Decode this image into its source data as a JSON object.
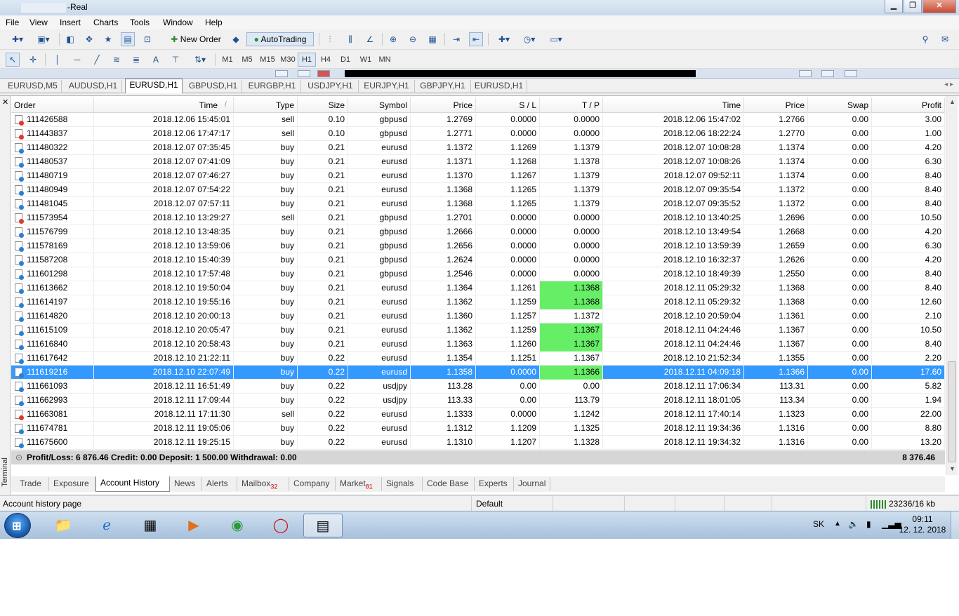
{
  "window": {
    "title": "-Real",
    "minimize": "▁",
    "restore": "❐",
    "close": "✕"
  },
  "menu": [
    "File",
    "View",
    "Insert",
    "Charts",
    "Tools",
    "Window",
    "Help"
  ],
  "toolbar": {
    "new_order": "New Order",
    "auto_trading": "AutoTrading",
    "timeframes": [
      "M1",
      "M5",
      "M15",
      "M30",
      "H1",
      "H4",
      "D1",
      "W1",
      "MN"
    ],
    "active_timeframe": "H1"
  },
  "chart_tabs": {
    "items": [
      "EURUSD,M5",
      "AUDUSD,H1",
      "EURUSD,H1",
      "GBPUSD,H1",
      "EURGBP,H1",
      "USDJPY,H1",
      "EURJPY,H1",
      "GBPJPY,H1",
      "EURUSD,H1"
    ],
    "active_index": 2,
    "arrows": "◂ ▸"
  },
  "terminal": {
    "side_label": "Terminal",
    "close": "✕",
    "columns": [
      "Order",
      "Time",
      "Type",
      "Size",
      "Symbol",
      "Price",
      "S / L",
      "T / P",
      "Time",
      "Price",
      "Swap",
      "Profit"
    ],
    "sort_indicator": "/",
    "rows": [
      {
        "order": "111426588",
        "open_time": "2018.12.06 15:45:01",
        "type": "sell",
        "size": "0.10",
        "symbol": "gbpusd",
        "price": "1.2769",
        "sl": "0.0000",
        "tp": "0.0000",
        "close_time": "2018.12.06 15:47:02",
        "close_price": "1.2766",
        "swap": "0.00",
        "profit": "3.00",
        "tp_hit": false
      },
      {
        "order": "111443837",
        "open_time": "2018.12.06 17:47:17",
        "type": "sell",
        "size": "0.10",
        "symbol": "gbpusd",
        "price": "1.2771",
        "sl": "0.0000",
        "tp": "0.0000",
        "close_time": "2018.12.06 18:22:24",
        "close_price": "1.2770",
        "swap": "0.00",
        "profit": "1.00",
        "tp_hit": false
      },
      {
        "order": "111480322",
        "open_time": "2018.12.07 07:35:45",
        "type": "buy",
        "size": "0.21",
        "symbol": "eurusd",
        "price": "1.1372",
        "sl": "1.1269",
        "tp": "1.1379",
        "close_time": "2018.12.07 10:08:28",
        "close_price": "1.1374",
        "swap": "0.00",
        "profit": "4.20",
        "tp_hit": false
      },
      {
        "order": "111480537",
        "open_time": "2018.12.07 07:41:09",
        "type": "buy",
        "size": "0.21",
        "symbol": "eurusd",
        "price": "1.1371",
        "sl": "1.1268",
        "tp": "1.1378",
        "close_time": "2018.12.07 10:08:26",
        "close_price": "1.1374",
        "swap": "0.00",
        "profit": "6.30",
        "tp_hit": false
      },
      {
        "order": "111480719",
        "open_time": "2018.12.07 07:46:27",
        "type": "buy",
        "size": "0.21",
        "symbol": "eurusd",
        "price": "1.1370",
        "sl": "1.1267",
        "tp": "1.1379",
        "close_time": "2018.12.07 09:52:11",
        "close_price": "1.1374",
        "swap": "0.00",
        "profit": "8.40",
        "tp_hit": false
      },
      {
        "order": "111480949",
        "open_time": "2018.12.07 07:54:22",
        "type": "buy",
        "size": "0.21",
        "symbol": "eurusd",
        "price": "1.1368",
        "sl": "1.1265",
        "tp": "1.1379",
        "close_time": "2018.12.07 09:35:54",
        "close_price": "1.1372",
        "swap": "0.00",
        "profit": "8.40",
        "tp_hit": false
      },
      {
        "order": "111481045",
        "open_time": "2018.12.07 07:57:11",
        "type": "buy",
        "size": "0.21",
        "symbol": "eurusd",
        "price": "1.1368",
        "sl": "1.1265",
        "tp": "1.1379",
        "close_time": "2018.12.07 09:35:52",
        "close_price": "1.1372",
        "swap": "0.00",
        "profit": "8.40",
        "tp_hit": false
      },
      {
        "order": "111573954",
        "open_time": "2018.12.10 13:29:27",
        "type": "sell",
        "size": "0.21",
        "symbol": "gbpusd",
        "price": "1.2701",
        "sl": "0.0000",
        "tp": "0.0000",
        "close_time": "2018.12.10 13:40:25",
        "close_price": "1.2696",
        "swap": "0.00",
        "profit": "10.50",
        "tp_hit": false
      },
      {
        "order": "111576799",
        "open_time": "2018.12.10 13:48:35",
        "type": "buy",
        "size": "0.21",
        "symbol": "gbpusd",
        "price": "1.2666",
        "sl": "0.0000",
        "tp": "0.0000",
        "close_time": "2018.12.10 13:49:54",
        "close_price": "1.2668",
        "swap": "0.00",
        "profit": "4.20",
        "tp_hit": false
      },
      {
        "order": "111578169",
        "open_time": "2018.12.10 13:59:06",
        "type": "buy",
        "size": "0.21",
        "symbol": "gbpusd",
        "price": "1.2656",
        "sl": "0.0000",
        "tp": "0.0000",
        "close_time": "2018.12.10 13:59:39",
        "close_price": "1.2659",
        "swap": "0.00",
        "profit": "6.30",
        "tp_hit": false
      },
      {
        "order": "111587208",
        "open_time": "2018.12.10 15:40:39",
        "type": "buy",
        "size": "0.21",
        "symbol": "gbpusd",
        "price": "1.2624",
        "sl": "0.0000",
        "tp": "0.0000",
        "close_time": "2018.12.10 16:32:37",
        "close_price": "1.2626",
        "swap": "0.00",
        "profit": "4.20",
        "tp_hit": false
      },
      {
        "order": "111601298",
        "open_time": "2018.12.10 17:57:48",
        "type": "buy",
        "size": "0.21",
        "symbol": "gbpusd",
        "price": "1.2546",
        "sl": "0.0000",
        "tp": "0.0000",
        "close_time": "2018.12.10 18:49:39",
        "close_price": "1.2550",
        "swap": "0.00",
        "profit": "8.40",
        "tp_hit": false
      },
      {
        "order": "111613662",
        "open_time": "2018.12.10 19:50:04",
        "type": "buy",
        "size": "0.21",
        "symbol": "eurusd",
        "price": "1.1364",
        "sl": "1.1261",
        "tp": "1.1368",
        "close_time": "2018.12.11 05:29:32",
        "close_price": "1.1368",
        "swap": "0.00",
        "profit": "8.40",
        "tp_hit": true
      },
      {
        "order": "111614197",
        "open_time": "2018.12.10 19:55:16",
        "type": "buy",
        "size": "0.21",
        "symbol": "eurusd",
        "price": "1.1362",
        "sl": "1.1259",
        "tp": "1.1368",
        "close_time": "2018.12.11 05:29:32",
        "close_price": "1.1368",
        "swap": "0.00",
        "profit": "12.60",
        "tp_hit": true
      },
      {
        "order": "111614820",
        "open_time": "2018.12.10 20:00:13",
        "type": "buy",
        "size": "0.21",
        "symbol": "eurusd",
        "price": "1.1360",
        "sl": "1.1257",
        "tp": "1.1372",
        "close_time": "2018.12.10 20:59:04",
        "close_price": "1.1361",
        "swap": "0.00",
        "profit": "2.10",
        "tp_hit": false
      },
      {
        "order": "111615109",
        "open_time": "2018.12.10 20:05:47",
        "type": "buy",
        "size": "0.21",
        "symbol": "eurusd",
        "price": "1.1362",
        "sl": "1.1259",
        "tp": "1.1367",
        "close_time": "2018.12.11 04:24:46",
        "close_price": "1.1367",
        "swap": "0.00",
        "profit": "10.50",
        "tp_hit": true
      },
      {
        "order": "111616840",
        "open_time": "2018.12.10 20:58:43",
        "type": "buy",
        "size": "0.21",
        "symbol": "eurusd",
        "price": "1.1363",
        "sl": "1.1260",
        "tp": "1.1367",
        "close_time": "2018.12.11 04:24:46",
        "close_price": "1.1367",
        "swap": "0.00",
        "profit": "8.40",
        "tp_hit": true
      },
      {
        "order": "111617642",
        "open_time": "2018.12.10 21:22:11",
        "type": "buy",
        "size": "0.22",
        "symbol": "eurusd",
        "price": "1.1354",
        "sl": "1.1251",
        "tp": "1.1367",
        "close_time": "2018.12.10 21:52:34",
        "close_price": "1.1355",
        "swap": "0.00",
        "profit": "2.20",
        "tp_hit": false
      },
      {
        "order": "111619216",
        "open_time": "2018.12.10 22:07:49",
        "type": "buy",
        "size": "0.22",
        "symbol": "eurusd",
        "price": "1.1358",
        "sl": "0.0000",
        "tp": "1.1366",
        "close_time": "2018.12.11 04:09:18",
        "close_price": "1.1366",
        "swap": "0.00",
        "profit": "17.60",
        "tp_hit": true,
        "selected": true
      },
      {
        "order": "111661093",
        "open_time": "2018.12.11 16:51:49",
        "type": "buy",
        "size": "0.22",
        "symbol": "usdjpy",
        "price": "113.28",
        "sl": "0.00",
        "tp": "0.00",
        "close_time": "2018.12.11 17:06:34",
        "close_price": "113.31",
        "swap": "0.00",
        "profit": "5.82",
        "tp_hit": false
      },
      {
        "order": "111662993",
        "open_time": "2018.12.11 17:09:44",
        "type": "buy",
        "size": "0.22",
        "symbol": "usdjpy",
        "price": "113.33",
        "sl": "0.00",
        "tp": "113.79",
        "close_time": "2018.12.11 18:01:05",
        "close_price": "113.34",
        "swap": "0.00",
        "profit": "1.94",
        "tp_hit": false
      },
      {
        "order": "111663081",
        "open_time": "2018.12.11 17:11:30",
        "type": "sell",
        "size": "0.22",
        "symbol": "eurusd",
        "price": "1.1333",
        "sl": "0.0000",
        "tp": "1.1242",
        "close_time": "2018.12.11 17:40:14",
        "close_price": "1.1323",
        "swap": "0.00",
        "profit": "22.00",
        "tp_hit": false
      },
      {
        "order": "111674781",
        "open_time": "2018.12.11 19:05:06",
        "type": "buy",
        "size": "0.22",
        "symbol": "eurusd",
        "price": "1.1312",
        "sl": "1.1209",
        "tp": "1.1325",
        "close_time": "2018.12.11 19:34:36",
        "close_price": "1.1316",
        "swap": "0.00",
        "profit": "8.80",
        "tp_hit": false
      },
      {
        "order": "111675600",
        "open_time": "2018.12.11 19:25:15",
        "type": "buy",
        "size": "0.22",
        "symbol": "eurusd",
        "price": "1.1310",
        "sl": "1.1207",
        "tp": "1.1328",
        "close_time": "2018.12.11 19:34:32",
        "close_price": "1.1316",
        "swap": "0.00",
        "profit": "13.20",
        "tp_hit": false
      }
    ],
    "summary": {
      "text": "Profit/Loss: 6 876.46  Credit: 0.00  Deposit: 1 500.00  Withdrawal: 0.00",
      "total": "8 376.46"
    },
    "bottom_tabs": [
      {
        "label": "Trade",
        "badge": ""
      },
      {
        "label": "Exposure",
        "badge": ""
      },
      {
        "label": "Account History",
        "badge": "",
        "active": true
      },
      {
        "label": "News",
        "badge": ""
      },
      {
        "label": "Alerts",
        "badge": ""
      },
      {
        "label": "Mailbox",
        "badge": "32"
      },
      {
        "label": "Company",
        "badge": ""
      },
      {
        "label": "Market",
        "badge": "81"
      },
      {
        "label": "Signals",
        "badge": ""
      },
      {
        "label": "Code Base",
        "badge": ""
      },
      {
        "label": "Experts",
        "badge": ""
      },
      {
        "label": "Journal",
        "badge": ""
      }
    ]
  },
  "statusbar": {
    "left": "Account history page",
    "profile": "Default",
    "traffic": "23236/16 kb"
  },
  "taskbar": {
    "lang": "SK",
    "time": "09:11",
    "date": "12. 12. 2018"
  },
  "colors": {
    "selected_row": "#3399ff",
    "tp_hit": "#66ee66"
  }
}
